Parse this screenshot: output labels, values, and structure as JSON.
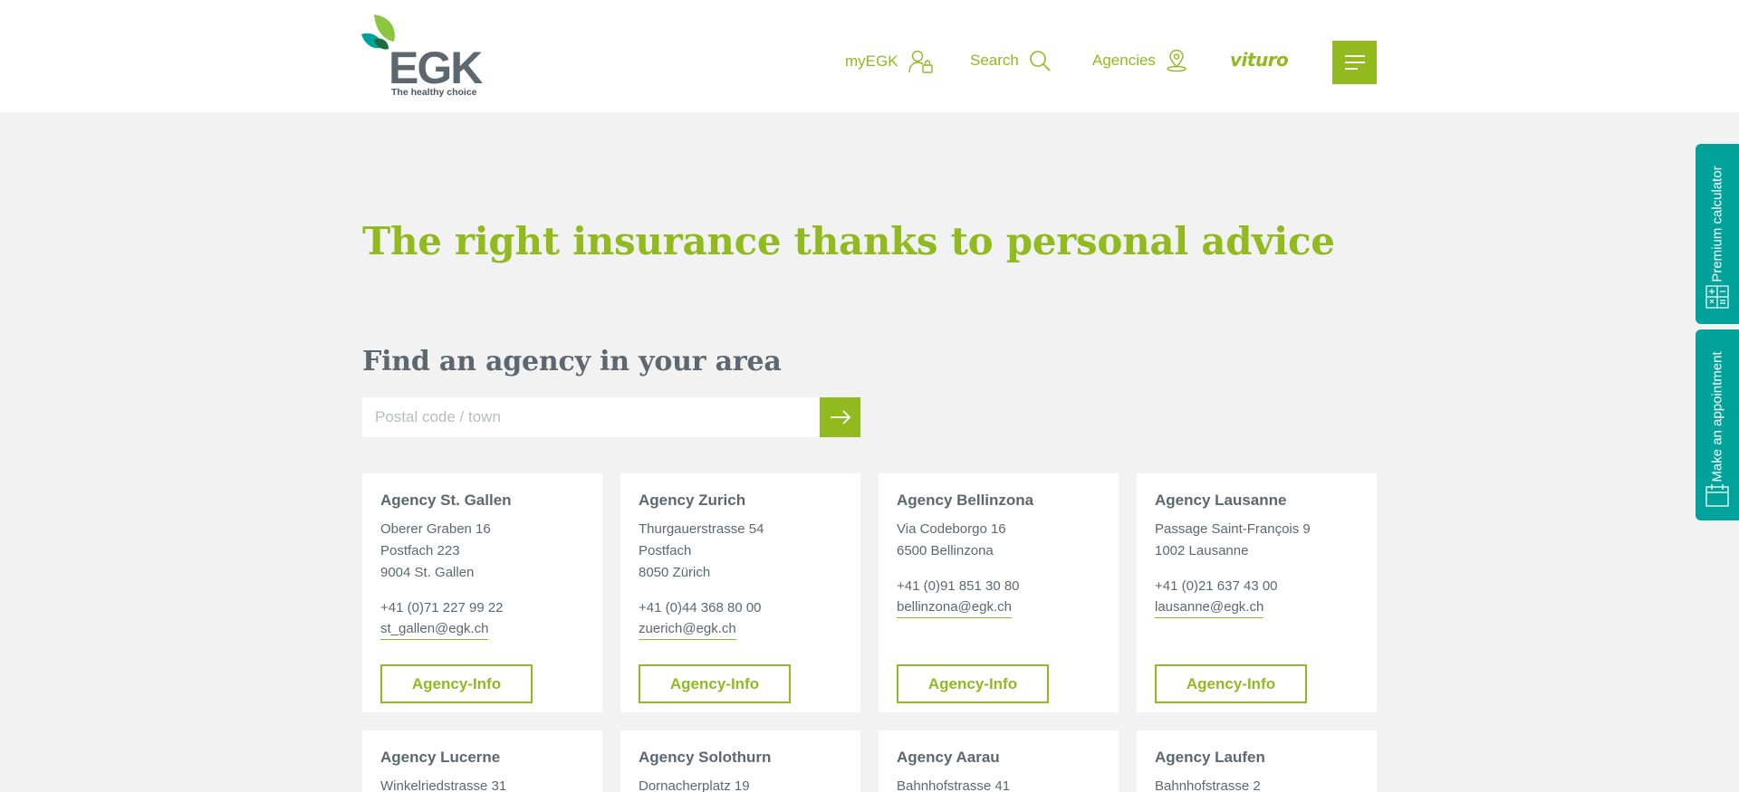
{
  "header": {
    "logo_text": "EGK",
    "logo_tagline": "The healthy choice",
    "nav": {
      "myegk": "myEGK",
      "search": "Search",
      "agencies": "Agencies",
      "vituro": "vituro"
    }
  },
  "hero": {
    "headline": "The right insurance thanks to personal advice"
  },
  "finder": {
    "title": "Find an agency in your area",
    "placeholder": "Postal code / town"
  },
  "side_tabs": {
    "premium": "Premium calculator",
    "appointment": "Make an appointment"
  },
  "agencies": [
    {
      "name": "Agency St. Gallen",
      "address": [
        "Oberer Graben 16",
        "Postfach 223",
        "9004 St. Gallen"
      ],
      "phone": "+41 (0)71 227 99 22",
      "email": "st_gallen@egk.ch",
      "button": "Agency-Info"
    },
    {
      "name": "Agency Zurich",
      "address": [
        "Thurgauerstrasse 54",
        "Postfach",
        "8050 Zürich"
      ],
      "phone": "+41 (0)44 368 80 00",
      "email": "zuerich@egk.ch",
      "button": "Agency-Info"
    },
    {
      "name": "Agency Bellinzona",
      "address": [
        "Via Codeborgo 16",
        "6500 Bellinzona"
      ],
      "phone": "+41 (0)91 851 30 80",
      "email": "bellinzona@egk.ch",
      "button": "Agency-Info"
    },
    {
      "name": "Agency Lausanne",
      "address": [
        "Passage Saint-François 9",
        "1002 Lausanne"
      ],
      "phone": "+41 (0)21 637 43 00",
      "email": "lausanne@egk.ch",
      "button": "Agency-Info"
    },
    {
      "name": "Agency Lucerne",
      "address": [
        "Winkelriedstrasse 31"
      ]
    },
    {
      "name": "Agency Solothurn",
      "address": [
        "Dornacherplatz 19"
      ]
    },
    {
      "name": "Agency Aarau",
      "address": [
        "Bahnhofstrasse 41"
      ]
    },
    {
      "name": "Agency Laufen",
      "address": [
        "Bahnhofstrasse 2"
      ]
    }
  ],
  "colors": {
    "brand_green": "#90ba1e",
    "teal": "#00a29a",
    "text_gray": "#5d6770",
    "background": "#f2f2f2"
  },
  "icons": {
    "myegk": "user-lock-icon",
    "search": "magnifier-icon",
    "agencies": "location-pin-icon",
    "menu": "hamburger-icon",
    "submit": "arrow-right-icon",
    "premium": "calculator-icon",
    "appointment": "calendar-icon"
  }
}
